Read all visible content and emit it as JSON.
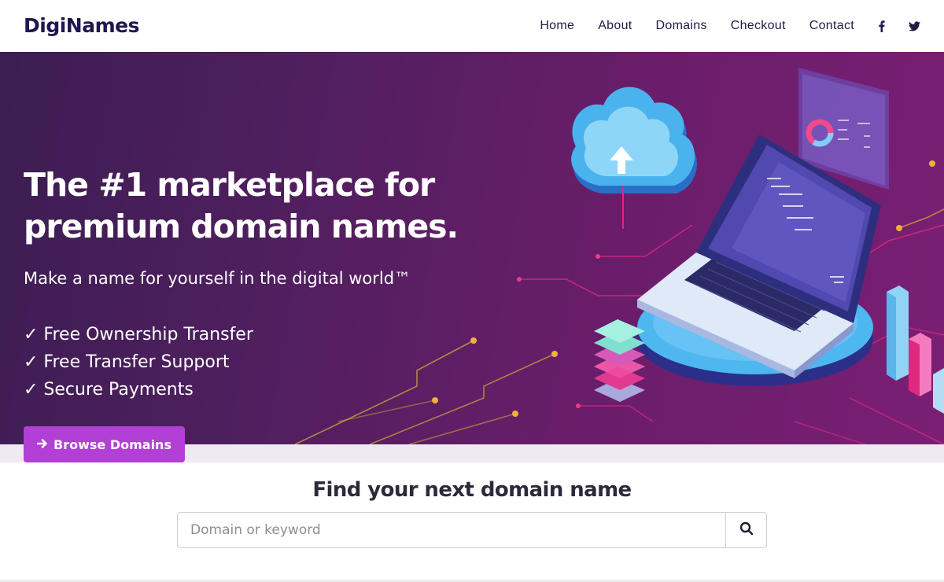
{
  "brand": {
    "logo_text": "DigiNames"
  },
  "nav": {
    "links": [
      "Home",
      "About",
      "Domains",
      "Checkout",
      "Contact"
    ],
    "social": {
      "facebook_label": "f",
      "twitter_icon": "twitter-icon"
    }
  },
  "hero": {
    "title": "The #1 marketplace for premium domain names.",
    "subtitle": "Make a name for yourself in the digital world™",
    "features": [
      "✓ Free Ownership Transfer",
      "✓ Free Transfer Support",
      "✓ Secure Payments"
    ],
    "cta_label": "Browse Domains",
    "cta_icon": "arrow-right-icon"
  },
  "search": {
    "heading": "Find your next domain name",
    "placeholder": "Domain or keyword",
    "button_icon": "search-icon"
  },
  "colors": {
    "accent": "#b23fd6",
    "navy": "#1e1650",
    "hero_start": "#3c1e52",
    "hero_end": "#7a1f74"
  }
}
